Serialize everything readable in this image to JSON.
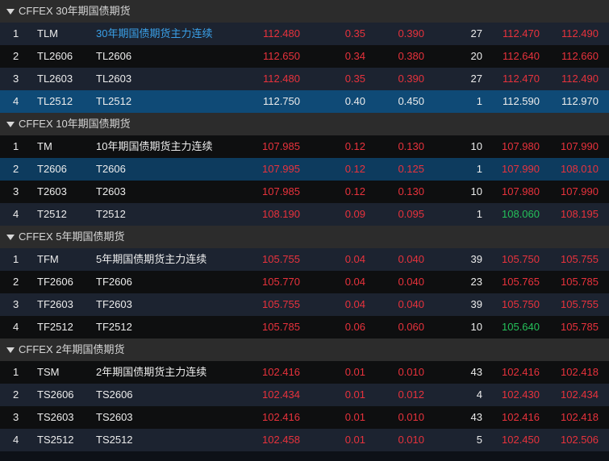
{
  "colors": {
    "up": "#e8323c",
    "down": "#25c05a",
    "link": "#3aa0e8",
    "selected": "#0f4a76"
  },
  "groups": [
    {
      "title": "CFFEX 30年期国债期货",
      "rows": [
        {
          "idx": "1",
          "code": "TLM",
          "name": "30年期国债期货主力连续",
          "price": "112.480",
          "chg": "0.35",
          "chgp": "0.390",
          "vol": "27",
          "bid": "112.470",
          "ask": "112.490",
          "nameColor": "blue",
          "priceColor": "red",
          "bidColor": "red",
          "askColor": "red",
          "style": "light"
        },
        {
          "idx": "2",
          "code": "TL2606",
          "name": "TL2606",
          "price": "112.650",
          "chg": "0.34",
          "chgp": "0.380",
          "vol": "20",
          "bid": "112.640",
          "ask": "112.660",
          "nameColor": "white",
          "priceColor": "red",
          "bidColor": "red",
          "askColor": "red",
          "style": "dark"
        },
        {
          "idx": "3",
          "code": "TL2603",
          "name": "TL2603",
          "price": "112.480",
          "chg": "0.35",
          "chgp": "0.390",
          "vol": "27",
          "bid": "112.470",
          "ask": "112.490",
          "nameColor": "white",
          "priceColor": "red",
          "bidColor": "red",
          "askColor": "red",
          "style": "light"
        },
        {
          "idx": "4",
          "code": "TL2512",
          "name": "TL2512",
          "price": "112.750",
          "chg": "0.40",
          "chgp": "0.450",
          "vol": "1",
          "bid": "112.590",
          "ask": "112.970",
          "nameColor": "white",
          "priceColor": "white",
          "bidColor": "white",
          "askColor": "white",
          "style": "sel"
        }
      ]
    },
    {
      "title": "CFFEX 10年期国债期货",
      "rows": [
        {
          "idx": "1",
          "code": "TM",
          "name": "10年期国债期货主力连续",
          "price": "107.985",
          "chg": "0.12",
          "chgp": "0.130",
          "vol": "10",
          "bid": "107.980",
          "ask": "107.990",
          "nameColor": "white",
          "priceColor": "red",
          "bidColor": "red",
          "askColor": "red",
          "style": "dark"
        },
        {
          "idx": "2",
          "code": "T2606",
          "name": "T2606",
          "price": "107.995",
          "chg": "0.12",
          "chgp": "0.125",
          "vol": "1",
          "bid": "107.990",
          "ask": "108.010",
          "nameColor": "white",
          "priceColor": "red",
          "bidColor": "red",
          "askColor": "red",
          "style": "sel2"
        },
        {
          "idx": "3",
          "code": "T2603",
          "name": "T2603",
          "price": "107.985",
          "chg": "0.12",
          "chgp": "0.130",
          "vol": "10",
          "bid": "107.980",
          "ask": "107.990",
          "nameColor": "white",
          "priceColor": "red",
          "bidColor": "red",
          "askColor": "red",
          "style": "dark"
        },
        {
          "idx": "4",
          "code": "T2512",
          "name": "T2512",
          "price": "108.190",
          "chg": "0.09",
          "chgp": "0.095",
          "vol": "1",
          "bid": "108.060",
          "ask": "108.195",
          "nameColor": "white",
          "priceColor": "red",
          "bidColor": "green",
          "askColor": "red",
          "style": "light"
        }
      ]
    },
    {
      "title": "CFFEX 5年期国债期货",
      "rows": [
        {
          "idx": "1",
          "code": "TFM",
          "name": "5年期国债期货主力连续",
          "price": "105.755",
          "chg": "0.04",
          "chgp": "0.040",
          "vol": "39",
          "bid": "105.750",
          "ask": "105.755",
          "nameColor": "white",
          "priceColor": "red",
          "bidColor": "red",
          "askColor": "red",
          "style": "light"
        },
        {
          "idx": "2",
          "code": "TF2606",
          "name": "TF2606",
          "price": "105.770",
          "chg": "0.04",
          "chgp": "0.040",
          "vol": "23",
          "bid": "105.765",
          "ask": "105.785",
          "nameColor": "white",
          "priceColor": "red",
          "bidColor": "red",
          "askColor": "red",
          "style": "dark"
        },
        {
          "idx": "3",
          "code": "TF2603",
          "name": "TF2603",
          "price": "105.755",
          "chg": "0.04",
          "chgp": "0.040",
          "vol": "39",
          "bid": "105.750",
          "ask": "105.755",
          "nameColor": "white",
          "priceColor": "red",
          "bidColor": "red",
          "askColor": "red",
          "style": "light"
        },
        {
          "idx": "4",
          "code": "TF2512",
          "name": "TF2512",
          "price": "105.785",
          "chg": "0.06",
          "chgp": "0.060",
          "vol": "10",
          "bid": "105.640",
          "ask": "105.785",
          "nameColor": "white",
          "priceColor": "red",
          "bidColor": "green",
          "askColor": "red",
          "style": "dark"
        }
      ]
    },
    {
      "title": "CFFEX 2年期国债期货",
      "rows": [
        {
          "idx": "1",
          "code": "TSM",
          "name": "2年期国债期货主力连续",
          "price": "102.416",
          "chg": "0.01",
          "chgp": "0.010",
          "vol": "43",
          "bid": "102.416",
          "ask": "102.418",
          "nameColor": "white",
          "priceColor": "red",
          "bidColor": "red",
          "askColor": "red",
          "style": "dark"
        },
        {
          "idx": "2",
          "code": "TS2606",
          "name": "TS2606",
          "price": "102.434",
          "chg": "0.01",
          "chgp": "0.012",
          "vol": "4",
          "bid": "102.430",
          "ask": "102.434",
          "nameColor": "white",
          "priceColor": "red",
          "bidColor": "red",
          "askColor": "red",
          "style": "light"
        },
        {
          "idx": "3",
          "code": "TS2603",
          "name": "TS2603",
          "price": "102.416",
          "chg": "0.01",
          "chgp": "0.010",
          "vol": "43",
          "bid": "102.416",
          "ask": "102.418",
          "nameColor": "white",
          "priceColor": "red",
          "bidColor": "red",
          "askColor": "red",
          "style": "dark"
        },
        {
          "idx": "4",
          "code": "TS2512",
          "name": "TS2512",
          "price": "102.458",
          "chg": "0.01",
          "chgp": "0.010",
          "vol": "5",
          "bid": "102.450",
          "ask": "102.506",
          "nameColor": "white",
          "priceColor": "red",
          "bidColor": "red",
          "askColor": "red",
          "style": "light"
        }
      ]
    }
  ]
}
